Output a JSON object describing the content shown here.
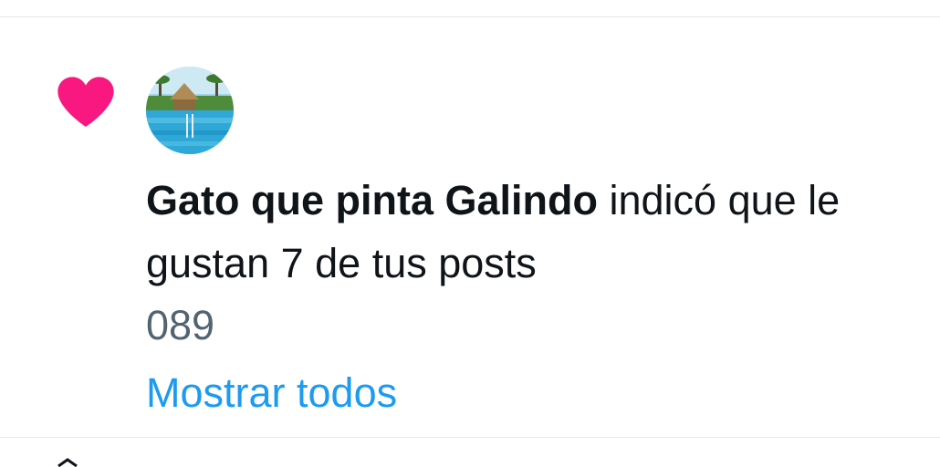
{
  "notification": {
    "icon": "heart-icon",
    "icon_color": "#f91880",
    "avatar": "avatar-pool-image",
    "actor_name": "Gato que pinta Galindo",
    "action_text": " indicó que le gustan 7 de tus posts",
    "post_excerpt": "089",
    "show_all_label": "Mostrar todos"
  },
  "colors": {
    "text_primary": "#0f1419",
    "text_secondary": "#536471",
    "link": "#1d9bf0",
    "divider": "#e4e8eb"
  }
}
